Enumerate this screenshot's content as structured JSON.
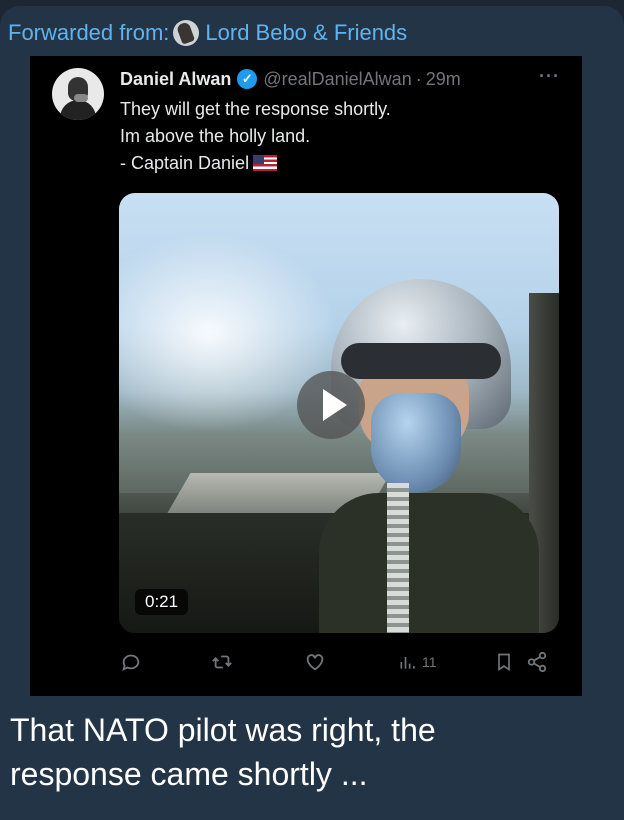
{
  "forward": {
    "prefix": "Forwarded from:",
    "channel": "Lord Bebo & Friends"
  },
  "tweet": {
    "author_name": "Daniel Alwan",
    "handle": "@realDanielAlwan",
    "separator": "·",
    "time": "29m",
    "more": "···",
    "lines": [
      "They will get the response shortly.",
      "Im above the holly land.",
      "- Captain Daniel"
    ],
    "video_duration": "0:21",
    "views": "11"
  },
  "message": {
    "lines": [
      "That NATO pilot was right, the",
      "response came shortly ..."
    ]
  },
  "icons": [
    "forward-avatar",
    "verified-icon",
    "more-icon",
    "us-flag-icon",
    "play-icon",
    "reply-icon",
    "retweet-icon",
    "like-icon",
    "views-icon",
    "bookmark-icon",
    "share-icon"
  ],
  "colors": {
    "link": "#5eb3f0",
    "verified": "#1d9bf0",
    "bubble": "#243447",
    "tweet_bg": "#000000"
  }
}
